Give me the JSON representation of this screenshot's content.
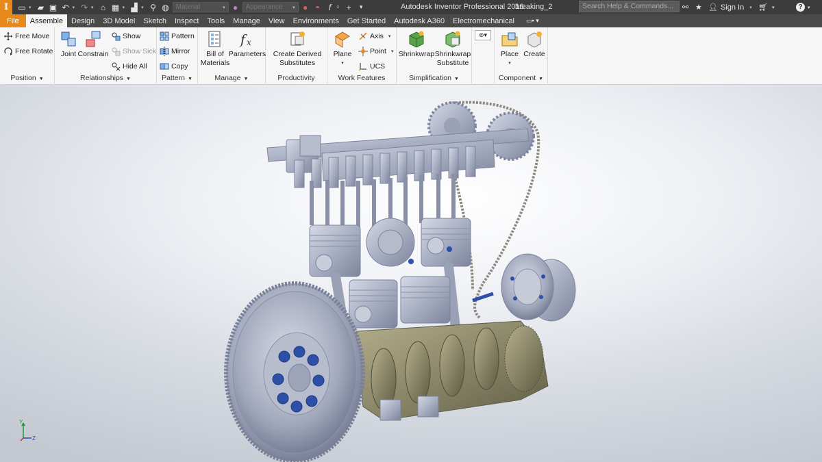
{
  "app": {
    "logo_letter": "I",
    "title": "Autodesk Inventor Professional 2018",
    "document": "breaking_2",
    "search_placeholder": "Search Help & Commands...",
    "sign_in": "Sign In",
    "material_placeholder": "Material",
    "appearance_placeholder": "Appearance"
  },
  "tabs": [
    {
      "label": "File"
    },
    {
      "label": "Assemble"
    },
    {
      "label": "Design"
    },
    {
      "label": "3D Model"
    },
    {
      "label": "Sketch"
    },
    {
      "label": "Inspect"
    },
    {
      "label": "Tools"
    },
    {
      "label": "Manage"
    },
    {
      "label": "View"
    },
    {
      "label": "Environments"
    },
    {
      "label": "Get Started"
    },
    {
      "label": "Autodesk A360"
    },
    {
      "label": "Electromechanical"
    }
  ],
  "ribbon": {
    "position": {
      "label": "Position",
      "free_move": "Free Move",
      "free_rotate": "Free Rotate"
    },
    "relationships": {
      "label": "Relationships",
      "joint": "Joint",
      "constrain": "Constrain",
      "show": "Show",
      "show_sick": "Show Sick",
      "hide_all": "Hide All"
    },
    "pattern": {
      "label": "Pattern",
      "pattern": "Pattern",
      "mirror": "Mirror",
      "copy": "Copy"
    },
    "manage": {
      "label": "Manage",
      "bom_line1": "Bill of",
      "bom_line2": "Materials",
      "parameters": "Parameters"
    },
    "productivity": {
      "label": "Productivity",
      "line1": "Create Derived",
      "line2": "Substitutes"
    },
    "work_features": {
      "label": "Work Features",
      "plane": "Plane",
      "axis": "Axis",
      "point": "Point",
      "ucs": "UCS"
    },
    "simplification": {
      "label": "Simplification",
      "shrinkwrap": "Shrinkwrap",
      "sws_line1": "Shrinkwrap",
      "sws_line2": "Substitute"
    },
    "component": {
      "label": "Component",
      "place": "Place",
      "create": "Create"
    }
  },
  "triad": {
    "y": "Y",
    "z": "Z"
  },
  "colors": {
    "file_tab": "#e8891d",
    "titlebar": "#3c3c3c",
    "tabbar": "#4a4a4a",
    "ribbon": "#f6f6f6",
    "model_grey": "#a9afc3",
    "bolts": "#2d4fa8",
    "crank": "#8a8668"
  }
}
